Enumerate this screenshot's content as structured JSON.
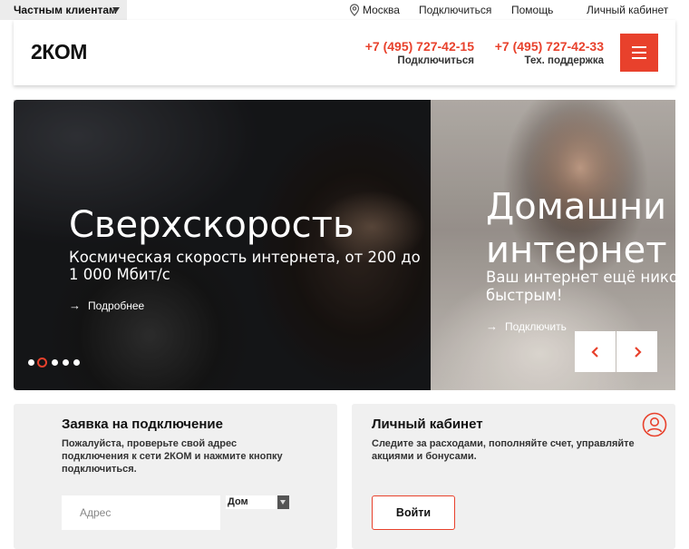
{
  "topbar": {
    "segment_label": "Частным клиентам",
    "city": "Москва",
    "links": [
      "Подключиться",
      "Помощь",
      "Личный кабинет"
    ]
  },
  "header": {
    "logo": "2КОМ",
    "phones": [
      {
        "number": "+7 (495) 727-42-15",
        "caption": "Подключиться"
      },
      {
        "number": "+7 (495) 727-42-33",
        "caption": "Тех. поддержка"
      }
    ],
    "accent_color": "#e8412c"
  },
  "hero": {
    "slides": [
      {
        "title": "Сверхскорость",
        "subtitle_line1": "Космическая скорость интернета, от 200 до",
        "subtitle_line2": "1 000 Мбит/с",
        "link": "Подробнее"
      },
      {
        "title_line1": "Домашни",
        "title_line2": "интернет",
        "subtitle_line1": "Ваш интернет ещё нико",
        "subtitle_line2": "быстрым!",
        "link": "Подключить"
      }
    ],
    "dots_count": 5,
    "active_dot": 1
  },
  "connect_card": {
    "title": "Заявка на подключение",
    "text_line1": "Пожалуйста, проверьте свой адрес",
    "text_line2": "подключения к сети 2КОМ и нажмите кнопку",
    "text_line3": "подключиться.",
    "address_placeholder": "Адрес",
    "house_select_value": "Дом"
  },
  "account_card": {
    "title": "Личный кабинет",
    "text_line1": "Следите за расходами, пополняйте счет, управляйте",
    "text_line2": "акциями и бонусами.",
    "login_label": "Войти"
  }
}
